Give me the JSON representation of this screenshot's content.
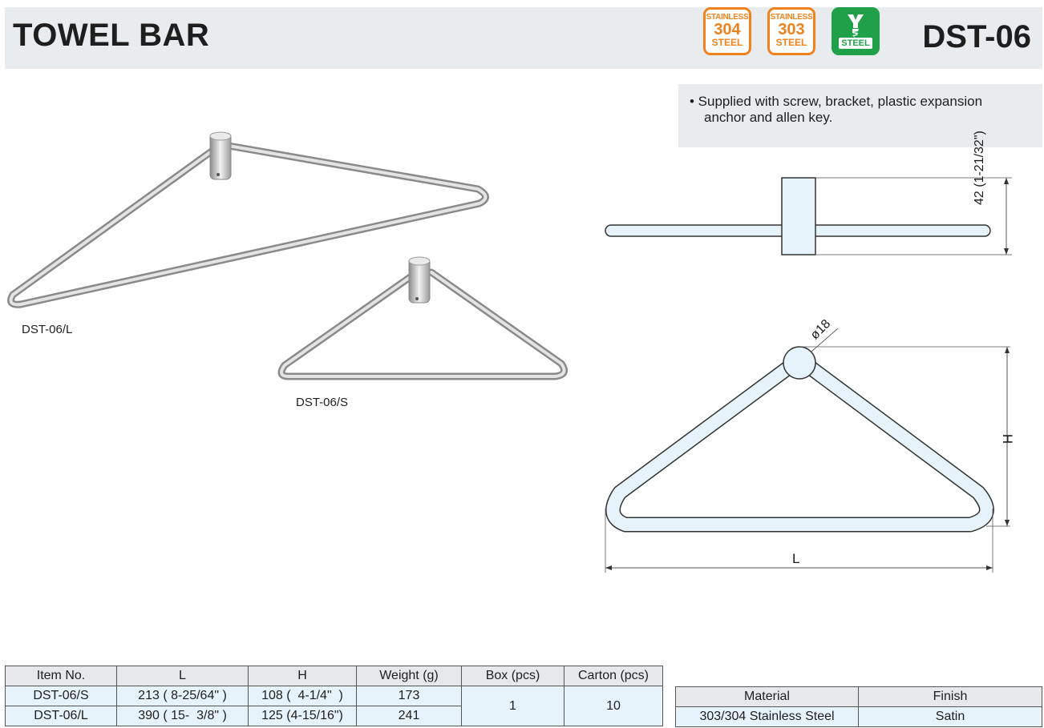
{
  "header": {
    "title": "TOWEL BAR",
    "code": "DST-06",
    "badges": [
      {
        "top": "STAINLESS",
        "num": "304",
        "bottom": "STEEL"
      },
      {
        "top": "STAINLESS",
        "num": "303",
        "bottom": "STEEL"
      },
      {
        "bottom": "STEEL"
      }
    ]
  },
  "note": {
    "line1": "• Supplied with screw, bracket, plastic expansion",
    "line2": "anchor and allen key."
  },
  "photos": {
    "large_label": "DST-06/L",
    "small_label": "DST-06/S"
  },
  "drawing": {
    "side_dim": "42 (1-21/32\")",
    "diameter": "ø18",
    "h_label": "H",
    "l_label": "L"
  },
  "spec_table": {
    "headers": [
      "Item No.",
      "L",
      "H",
      "Weight (g)",
      "Box (pcs)",
      "Carton (pcs)"
    ],
    "rows": [
      [
        "DST-06/S",
        "213 ( 8-25/64\" )",
        "108 (  4-1/4\"  )",
        "173"
      ],
      [
        "DST-06/L",
        "390 ( 15-  3/8\" )",
        "125 (4-15/16\")",
        "241"
      ]
    ],
    "box": "1",
    "carton": "10"
  },
  "material_table": {
    "headers": [
      "Material",
      "Finish"
    ],
    "row": [
      "303/304 Stainless Steel",
      "Satin"
    ]
  }
}
